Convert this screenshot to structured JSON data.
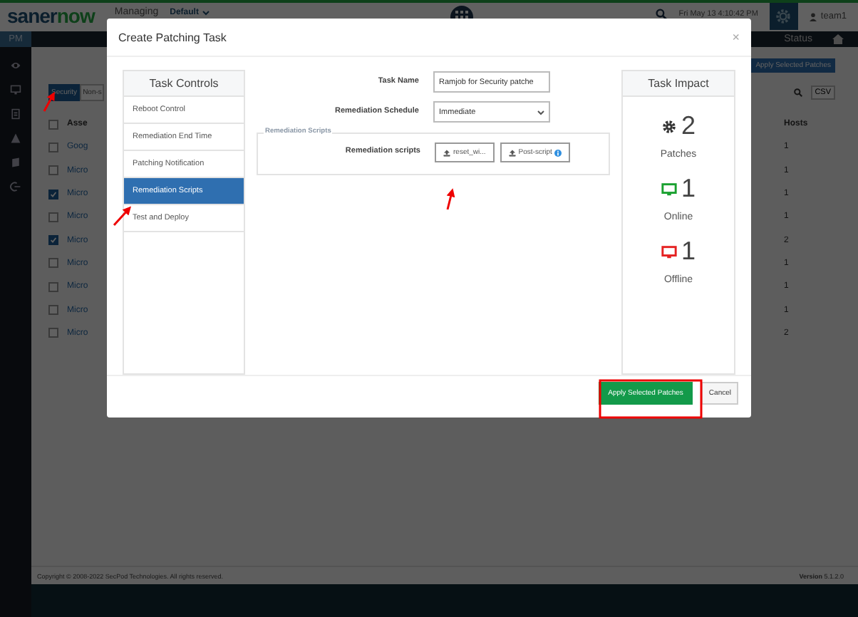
{
  "topbar": {
    "logo_main": "saner",
    "logo_accent": "now",
    "managing_label": "Managing",
    "account": "Default",
    "datetime": "Fri May 13  4:10:42 PM",
    "user": "team1"
  },
  "subbar": {
    "module": "PM",
    "links": [
      "Status"
    ]
  },
  "background": {
    "apply_button": "Apply Selected Patches",
    "csv_button": "CSV",
    "tabs": [
      {
        "label": "Security",
        "selected": true
      },
      {
        "label": "Non-s",
        "selected": false
      }
    ],
    "table": {
      "columns": [
        "Asse",
        "Hosts"
      ],
      "select_all_checked": false,
      "rows": [
        {
          "name": "Goog",
          "checked": false,
          "hosts": "1"
        },
        {
          "name": "Micro",
          "checked": false,
          "hosts": "1"
        },
        {
          "name": "Micro",
          "checked": true,
          "hosts": "1"
        },
        {
          "name": "Micro",
          "checked": false,
          "hosts": "1"
        },
        {
          "name": "Micro",
          "checked": true,
          "hosts": "2"
        },
        {
          "name": "Micro",
          "checked": false,
          "hosts": "1"
        },
        {
          "name": "Micro",
          "checked": false,
          "hosts": "1"
        },
        {
          "name": "Micro",
          "checked": false,
          "hosts": "1"
        },
        {
          "name": "Micro",
          "checked": false,
          "hosts": "2"
        }
      ]
    }
  },
  "footer": {
    "copyright": "Copyright © 2008-2022 SecPod Technologies. All rights reserved.",
    "version_label": "Version",
    "version": "5.1.2.0"
  },
  "dialog": {
    "title": "Create Patching Task",
    "close": "×",
    "task_controls": {
      "title": "Task Controls",
      "items": [
        {
          "label": "Reboot Control",
          "selected": false
        },
        {
          "label": "Remediation End Time",
          "selected": false
        },
        {
          "label": "Patching Notification",
          "selected": false
        },
        {
          "label": "Remediation Scripts",
          "selected": true
        },
        {
          "label": "Test and Deploy",
          "selected": false
        }
      ]
    },
    "form": {
      "task_name_label": "Task Name",
      "task_name": "Ramjob for Security patche",
      "schedule_label": "Remediation Schedule",
      "schedule": "Immediate",
      "scripts_legend": "Remediation Scripts",
      "scripts_label": "Remediation scripts",
      "script_buttons": [
        {
          "label": "reset_wi...",
          "info": false
        },
        {
          "label": "Post-script",
          "info": true
        }
      ]
    },
    "impact": {
      "title": "Task Impact",
      "stats": [
        {
          "kind": "patches",
          "value": "2",
          "label": "Patches"
        },
        {
          "kind": "online",
          "value": "1",
          "label": "Online"
        },
        {
          "kind": "offline",
          "value": "1",
          "label": "Offline"
        }
      ]
    },
    "buttons": [
      {
        "label": "Apply Selected Patches",
        "kind": "primary"
      },
      {
        "label": "Cancel",
        "kind": "default"
      }
    ]
  }
}
